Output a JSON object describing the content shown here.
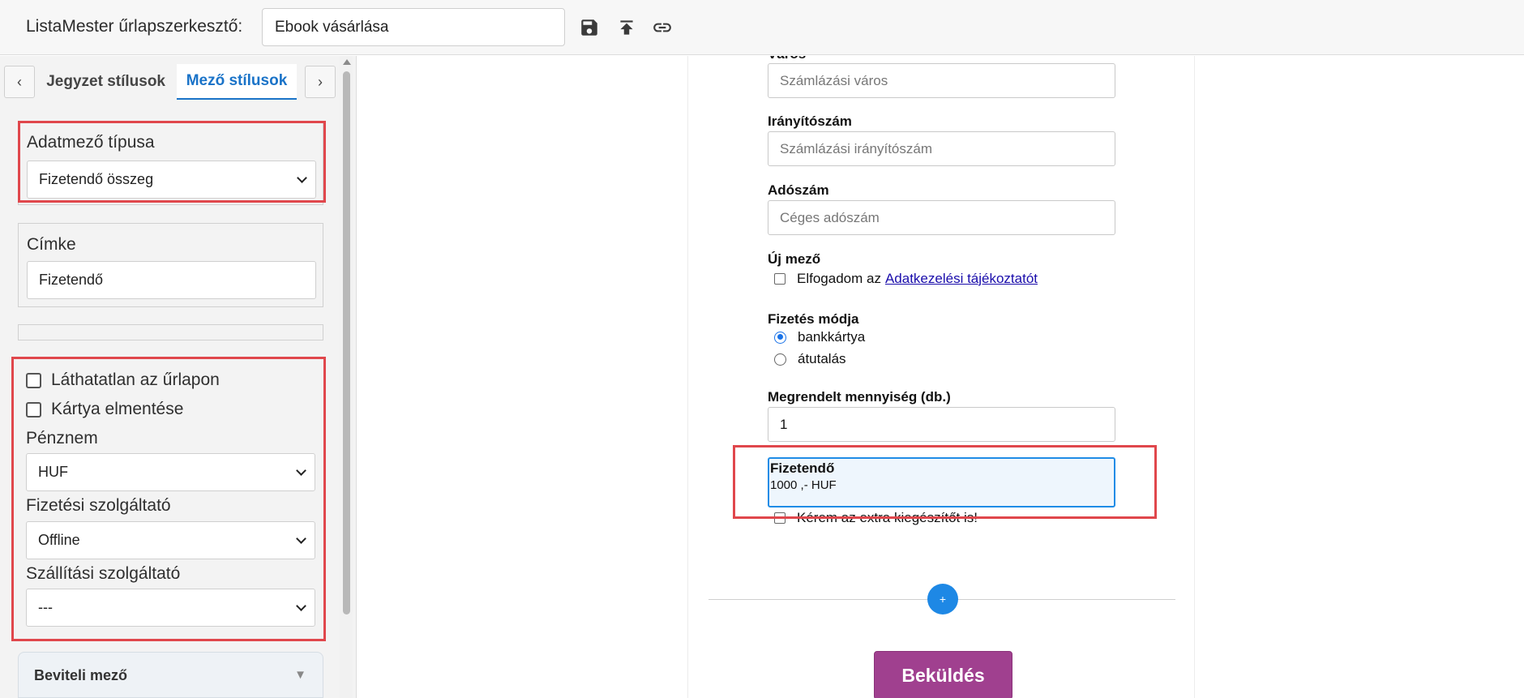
{
  "header": {
    "app_title": "ListaMester űrlapszerkesztő:",
    "form_name": "Ebook vásárlása",
    "icons": [
      "save-icon",
      "upload-icon",
      "link-icon"
    ]
  },
  "sidebar": {
    "tabs": [
      {
        "label": "Jegyzet stílusok",
        "active": false
      },
      {
        "label": "Mező stílusok",
        "active": true
      }
    ],
    "prev_arrow": "‹",
    "next_arrow": "›",
    "field_type": {
      "label": "Adatmező típusa",
      "value": "Fizetendő összeg"
    },
    "caption": {
      "label": "Címke",
      "value": "Fizetendő"
    },
    "options": {
      "invisible": "Láthatatlan az űrlapon",
      "save_card": "Kártya elmentése",
      "currency_label": "Pénznem",
      "currency_value": "HUF",
      "payment_provider_label": "Fizetési szolgáltató",
      "payment_provider_value": "Offline",
      "shipping_provider_label": "Szállítási szolgáltató",
      "shipping_provider_value": "---"
    },
    "accordion": {
      "title": "Beviteli mező",
      "arrow": "▼"
    }
  },
  "form": {
    "city_label_partial": "Város",
    "city_placeholder": "Számlázási város",
    "zip_label": "Irányítószám",
    "zip_placeholder": "Számlázási irányítószám",
    "tax_label": "Adószám",
    "tax_placeholder": "Céges adószám",
    "new_field_label": "Új mező",
    "consent_text": "Elfogadom az",
    "consent_link": "Adatkezelési tájékoztatót",
    "payment_method_label": "Fizetés módja",
    "payment_options": [
      "bankkártya",
      "átutalás"
    ],
    "payment_selected": "bankkártya",
    "quantity_label": "Megrendelt mennyiség (db.)",
    "quantity_value": "1",
    "payable_label": "Fizetendő",
    "payable_value": "1000 ,- HUF",
    "extra_text": "Kérem az extra kiegészítőt is!",
    "add_symbol": "+",
    "submit_label": "Beküldés"
  },
  "colors": {
    "accent": "#1a73c8",
    "highlight": "#e0474c",
    "submit": "#a0408f",
    "add_button": "#1e88e5"
  }
}
